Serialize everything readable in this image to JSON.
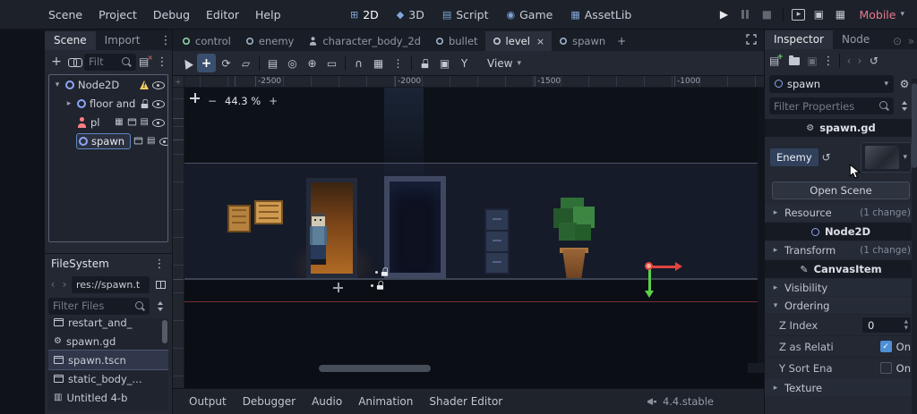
{
  "colors": {
    "accent": "#699ce8",
    "selection_outline": "#5f87c0",
    "warning": "#f0cd5e",
    "renderer_text": "#e9798f",
    "axis_x": "#e0453f",
    "axis_y": "#5ad14a",
    "node2d_icon": "#8da5f3",
    "character_icon": "#fc7f7f"
  },
  "icons": {
    "search": "css-magnifier",
    "visibility": "css-eye",
    "lock": "css-padlock",
    "warning": "css-warning-triangle",
    "node2d": "blue-circle",
    "character_body": "pink-person",
    "scene_file": "clapperboard",
    "script_file": "lined-page"
  },
  "topbar": {
    "menus": [
      "Scene",
      "Project",
      "Debug",
      "Editor",
      "Help"
    ],
    "workspaces": [
      "2D",
      "3D",
      "Script",
      "Game",
      "AssetLib"
    ],
    "renderer": "Mobile"
  },
  "scene_dock": {
    "tabs": [
      "Scene",
      "Import"
    ],
    "filter_placeholder": "Filt",
    "tree": {
      "node2d": "Node2D",
      "floor": "floor and",
      "pl": "pl",
      "spawn": "spawn"
    }
  },
  "filesystem": {
    "title": "FileSystem",
    "path": "res://spawn.t",
    "filter_placeholder": "Filter Files",
    "files": [
      "restart_and_",
      "spawn.gd",
      "spawn.tscn",
      "static_body_...",
      "Untitled 4-b"
    ]
  },
  "viewport": {
    "tabs": [
      "control",
      "enemy",
      "character_body_2d",
      "bullet",
      "level",
      "spawn"
    ],
    "active_tab": "level",
    "zoom": "44.3 %",
    "view_label": "View",
    "ruler_labels": [
      "-2500",
      "-2000",
      "-1500",
      "-1000"
    ]
  },
  "bottom_bar": {
    "panels": [
      "Output",
      "Debugger",
      "Audio",
      "Animation",
      "Shader Editor"
    ],
    "version": "4.4.stable"
  },
  "inspector": {
    "tabs": [
      "Inspector",
      "Node"
    ],
    "node_name": "spawn",
    "filter_placeholder": "Filter Properties",
    "script_section": "spawn.gd",
    "properties": {
      "enemy_label": "Enemy",
      "open_scene": "Open Scene",
      "resource": {
        "label": "Resource",
        "badge": "(1 change)"
      },
      "node2d_section": "Node2D",
      "transform": {
        "label": "Transform",
        "badge": "(1 change)"
      },
      "canvasitem_section": "CanvasItem",
      "visibility": "Visibility",
      "ordering": "Ordering",
      "z_index": {
        "label": "Z Index",
        "value": "0"
      },
      "z_as_relative": {
        "label": "Z as Relati",
        "value": "On"
      },
      "y_sort": {
        "label": "Y Sort Ena",
        "value": "On"
      },
      "texture": "Texture"
    }
  }
}
